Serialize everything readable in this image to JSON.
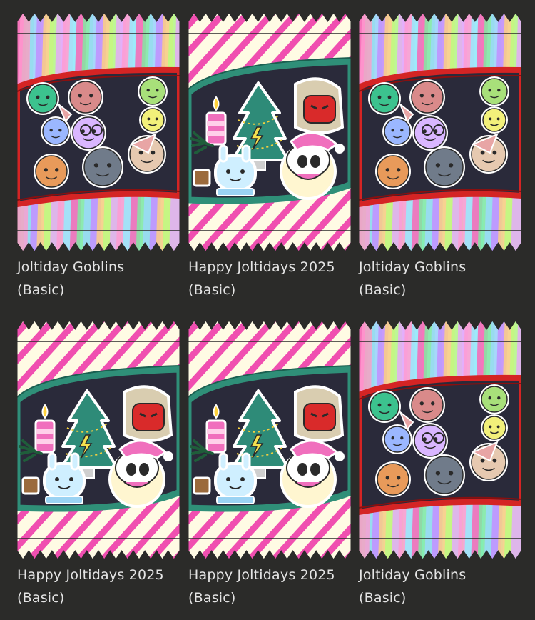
{
  "packs": [
    {
      "kind": "goblins",
      "name": "Joltiday Goblins",
      "tier": "(Basic)"
    },
    {
      "kind": "holiday",
      "name": "Happy Joltidays 2025",
      "tier": "(Basic)"
    },
    {
      "kind": "goblins",
      "name": "Joltiday Goblins",
      "tier": "(Basic)"
    },
    {
      "kind": "holiday",
      "name": "Happy Joltidays 2025",
      "tier": "(Basic)"
    },
    {
      "kind": "holiday",
      "name": "Happy Joltidays 2025",
      "tier": "(Basic)"
    },
    {
      "kind": "goblins",
      "name": "Joltiday Goblins",
      "tier": "(Basic)"
    }
  ],
  "colors": {
    "background": "#2b2b29",
    "text": "#e4e4e4",
    "holiday_stripe": "#f04fb0",
    "holiday_base": "#fffbe4",
    "holiday_band": "#2f8f78",
    "goblins_band": "#d42424",
    "window_dark": "#2a2a3a"
  }
}
